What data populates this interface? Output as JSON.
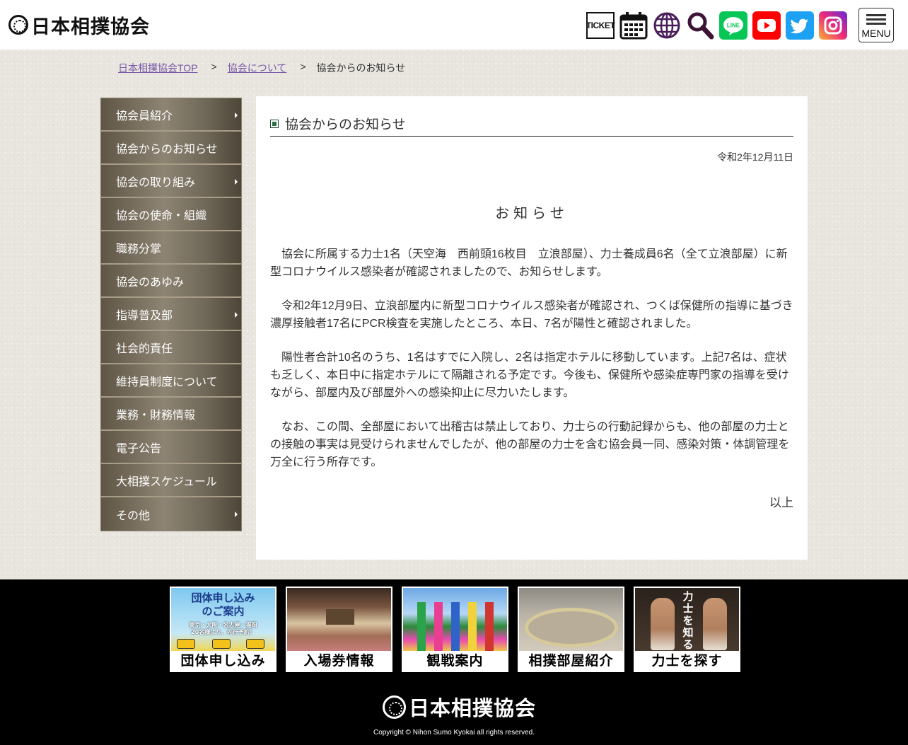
{
  "header": {
    "logo_text": "日本相撲協会",
    "ticket_label": "TICKET",
    "menu_label": "MENU",
    "icons": [
      "ticket-icon",
      "calendar-icon",
      "globe-icon",
      "search-icon",
      "line-icon",
      "youtube-icon",
      "twitter-icon",
      "instagram-icon"
    ]
  },
  "breadcrumb": {
    "home": "日本相撲協会TOP",
    "sep": ">",
    "about": "協会について",
    "current": "協会からのお知らせ"
  },
  "sidebar": {
    "items": [
      {
        "label": "協会員紹介",
        "has_sub": true
      },
      {
        "label": "協会からのお知らせ",
        "has_sub": false
      },
      {
        "label": "協会の取り組み",
        "has_sub": true
      },
      {
        "label": "協会の使命・組織",
        "has_sub": false
      },
      {
        "label": "職務分掌",
        "has_sub": false
      },
      {
        "label": "協会のあゆみ",
        "has_sub": false
      },
      {
        "label": "指導普及部",
        "has_sub": true
      },
      {
        "label": "社会的責任",
        "has_sub": false
      },
      {
        "label": "維持員制度について",
        "has_sub": false
      },
      {
        "label": "業務・財務情報",
        "has_sub": false
      },
      {
        "label": "電子公告",
        "has_sub": false
      },
      {
        "label": "大相撲スケジュール",
        "has_sub": false
      },
      {
        "label": "その他",
        "has_sub": true
      }
    ]
  },
  "main": {
    "title": "協会からのお知らせ",
    "date": "令和2年12月11日",
    "heading": "お知らせ",
    "paragraphs": [
      "　協会に所属する力士1名（天空海　西前頭16枚目　立浪部屋）、力士養成員6名（全て立浪部屋）に新型コロナウイルス感染者が確認されましたので、お知らせします。",
      "　令和2年12月9日、立浪部屋内に新型コロナウイルス感染者が確認され、つくば保健所の指導に基づき濃厚接触者17名にPCR検査を実施したところ、本日、7名が陽性と確認されました。",
      "　陽性者合計10名のうち、1名はすでに入院し、2名は指定ホテルに移動しています。上記7名は、症状も乏しく、本日中に指定ホテルにて隔離される予定です。今後も、保健所や感染症専門家の指導を受けながら、部屋内及び部屋外への感染抑止に尽力いたします。",
      "　なお、この間、全部屋において出稽古は禁止しており、力士らの行動記録からも、他の部屋の力士との接触の事実は見受けられませんでしたが、他の部屋の力士を含む協会員一同、感染対策・体調管理を万全に行う所存です。"
    ],
    "closing": "以上"
  },
  "footer": {
    "banners": [
      {
        "caption": "団体申し込み",
        "promo_title": "団体申し込み\nのご案内",
        "promo_sub": "東京・大阪・名古屋・福岡\n20名様より、先行予約！"
      },
      {
        "caption": "入場券情報"
      },
      {
        "caption": "観戦案内"
      },
      {
        "caption": "相撲部屋紹介"
      },
      {
        "caption": "力士を探す",
        "vertical_text": "力士を知る"
      }
    ],
    "logo_text": "日本相撲協会",
    "copyright": "Copyright © Nihon Sumo Kyokai all rights reserved."
  },
  "colors": {
    "link": "#7a58a8",
    "line_green": "#06c755",
    "youtube_red": "#ff0000",
    "twitter_blue": "#1da1f2",
    "globe_purple": "#4a1e5a",
    "search_purple": "#3d1436"
  }
}
